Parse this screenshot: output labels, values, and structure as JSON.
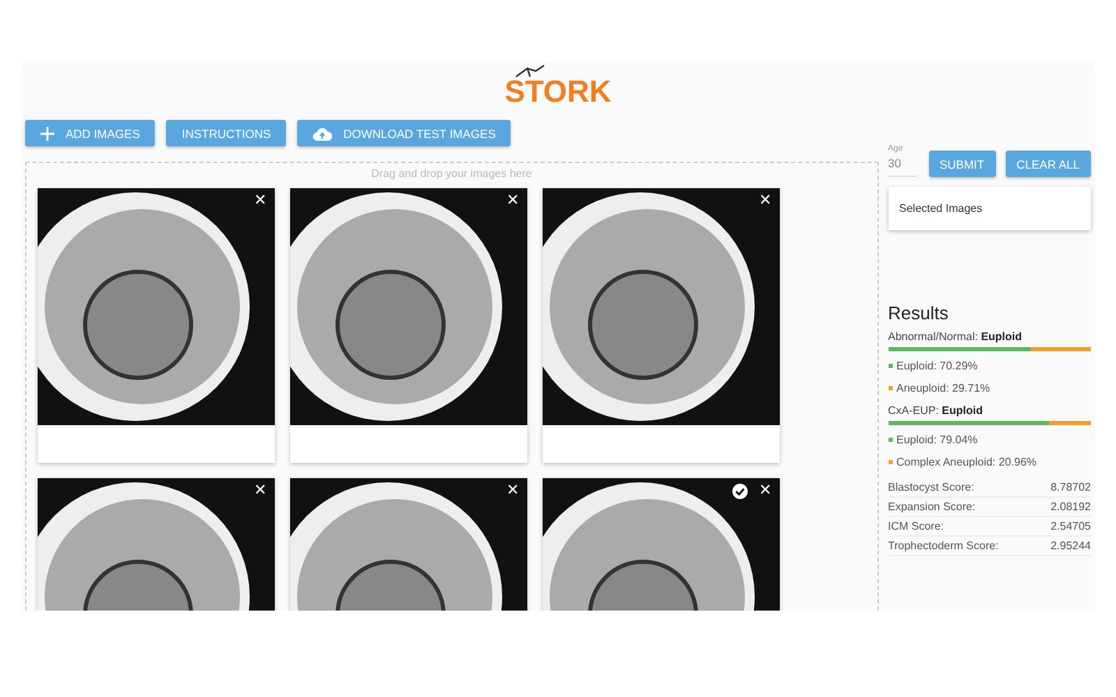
{
  "logo": "STORK",
  "toolbar": [
    {
      "label": "ADD IMAGES"
    },
    {
      "label": "INSTRUCTIONS"
    },
    {
      "label": "DOWNLOAD TEST IMAGES"
    }
  ],
  "dropzone": {
    "hint": "Drag and drop your images here"
  },
  "images": [
    {
      "selected": false,
      "remove": "✕"
    },
    {
      "selected": false,
      "remove": "✕"
    },
    {
      "selected": false,
      "remove": "✕"
    },
    {
      "selected": false,
      "remove": "✕"
    },
    {
      "selected": false,
      "remove": "✕"
    },
    {
      "selected": true,
      "remove": "✕"
    }
  ],
  "age": {
    "label": "Age",
    "value": "30"
  },
  "actions": [
    "SUBMIT",
    "CLEAR ALL"
  ],
  "selected_images": {
    "title": "Selected Images"
  },
  "results": {
    "title": "Results",
    "groups": [
      {
        "label": "Abnormal/Normal:",
        "value": "Euploid",
        "level": 0.7029,
        "items": [
          {
            "text": "Euploid: 70.29%",
            "color": "#5cb85c"
          },
          {
            "text": "Aneuploid: 29.71%",
            "color": "#f0a030"
          }
        ]
      },
      {
        "label": "CxA-EUP:",
        "value": "Euploid",
        "level": 0.7904,
        "items": [
          {
            "text": "Euploid: 79.04%",
            "color": "#5cb85c"
          },
          {
            "text": "Complex Aneuploid: 20.96%",
            "color": "#f0a030"
          }
        ]
      }
    ],
    "scores": [
      {
        "name": "Blastocyst Score:",
        "value": "8.78702"
      },
      {
        "name": "Expansion Score:",
        "value": "2.08192"
      },
      {
        "name": "ICM Score:",
        "value": "2.54705"
      },
      {
        "name": "Trophectoderm Score:",
        "value": "2.95244"
      }
    ]
  }
}
